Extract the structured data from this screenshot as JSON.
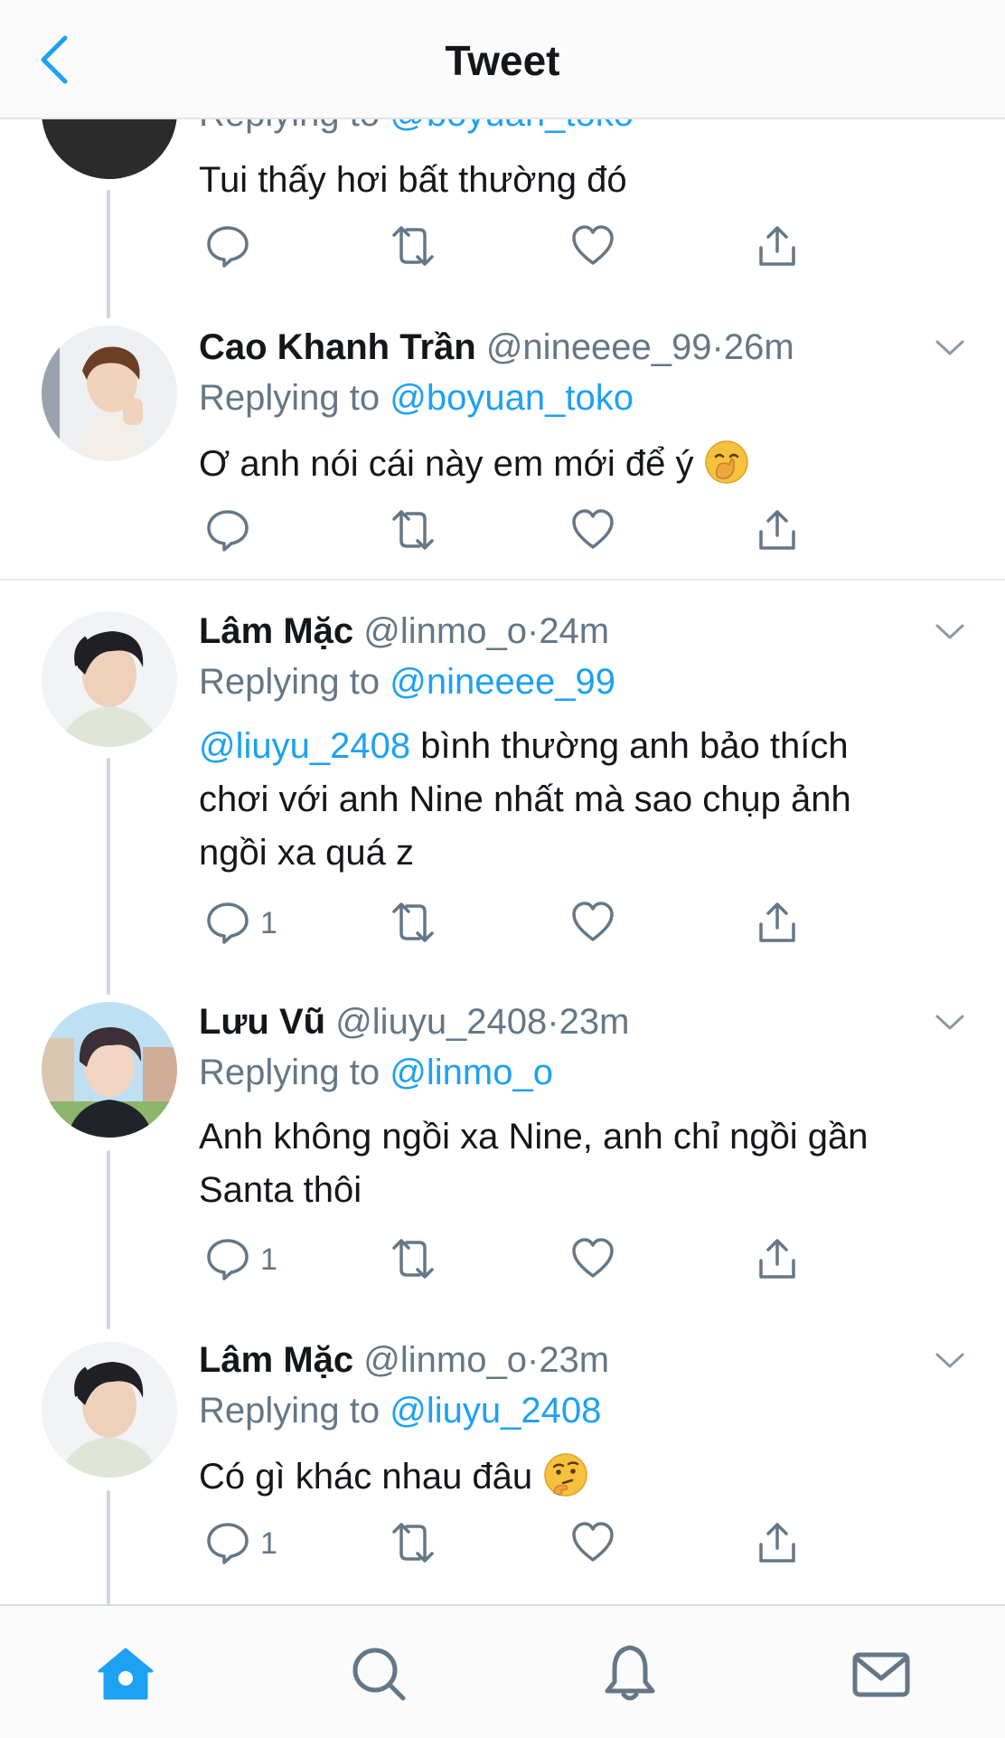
{
  "header": {
    "title": "Tweet"
  },
  "colors": {
    "accent": "#1da1f2",
    "secondary": "#657786",
    "text": "#14171a",
    "thread": "#cdd6dd"
  },
  "tweets": [
    {
      "replying_label": "Replying to",
      "replying_to": "@boyuan_toko",
      "text": "Tui thấy hơi bất thường đó",
      "reply_count": ""
    },
    {
      "name": "Cao Khanh Trần",
      "handle": "@nineeee_99",
      "sep": "·",
      "time": "26m",
      "replying_label": "Replying to",
      "replying_to": "@boyuan_toko",
      "text": "Ơ anh nói cái này em mới để ý",
      "emoji": "face-with-hand-over-mouth-emoji",
      "reply_count": ""
    },
    {
      "name": "Lâm Mặc",
      "handle": "@linmo_o",
      "sep": "·",
      "time": "24m",
      "replying_label": "Replying to",
      "replying_to": "@nineeee_99",
      "mention": "@liuyu_2408",
      "text_line1_rest": "bình thường anh bảo thích",
      "text_line2": "chơi với anh Nine nhất mà sao chụp ảnh",
      "text_line3": "ngồi xa quá z",
      "reply_count": "1"
    },
    {
      "name": "Lưu Vũ",
      "handle": "@liuyu_2408",
      "sep": "·",
      "time": "23m",
      "replying_label": "Replying to",
      "replying_to": "@linmo_o",
      "text_line1": "Anh không ngồi xa Nine, anh chỉ ngồi gần",
      "text_line2": "Santa thôi",
      "reply_count": "1"
    },
    {
      "name": "Lâm Mặc",
      "handle": "@linmo_o",
      "sep": "·",
      "time": "23m",
      "replying_label": "Replying to",
      "replying_to": "@liuyu_2408",
      "text": "Có gì khác nhau đâu",
      "emoji": "thinking-face-emoji",
      "reply_count": "1"
    }
  ],
  "tabbar": {
    "items": [
      "home-icon",
      "search-icon",
      "notifications-icon",
      "messages-icon"
    ]
  }
}
